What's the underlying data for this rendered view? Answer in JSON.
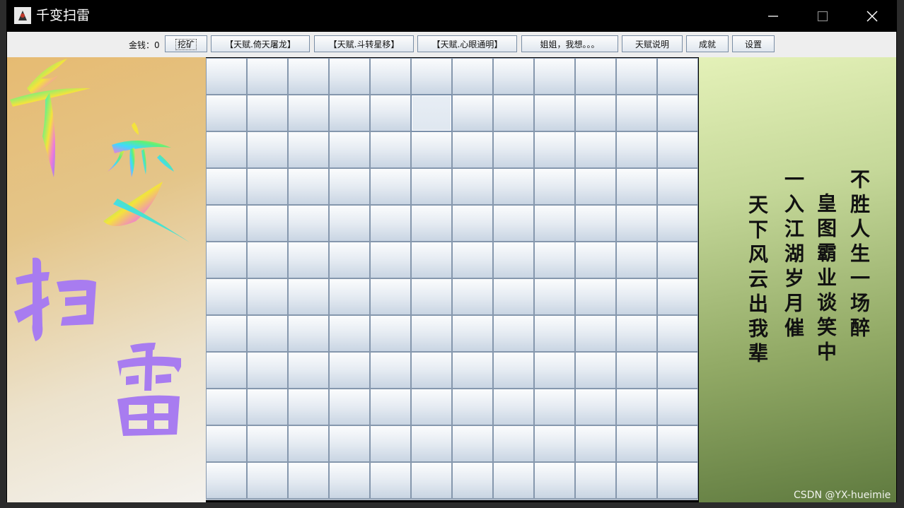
{
  "window": {
    "title": "千变扫雷"
  },
  "toolbar": {
    "money_label": "金钱：0",
    "buttons": [
      {
        "label": "挖矿"
      },
      {
        "label": "【天赋.倚天屠龙】"
      },
      {
        "label": "【天赋.斗转星移】"
      },
      {
        "label": "【天赋.心眼通明】"
      },
      {
        "label": "姐姐，我想。。。"
      },
      {
        "label": "天赋说明"
      },
      {
        "label": "成就"
      },
      {
        "label": "设置"
      }
    ]
  },
  "banner": {
    "chars": [
      "千",
      "变",
      "扫",
      "雷"
    ]
  },
  "board": {
    "rows": 12,
    "cols": 12,
    "highlighted_cell": {
      "row": 2,
      "col": 6
    }
  },
  "poem": {
    "columns": [
      "不胜人生一场醉",
      "皇图霸业谈笑中",
      "一入江湖岁月催",
      "天下风云出我辈"
    ]
  },
  "watermark": "CSDN @YX-hueimie",
  "colors": {
    "banner_purple": "#a87cf0",
    "cell_border": "#8597ad"
  }
}
